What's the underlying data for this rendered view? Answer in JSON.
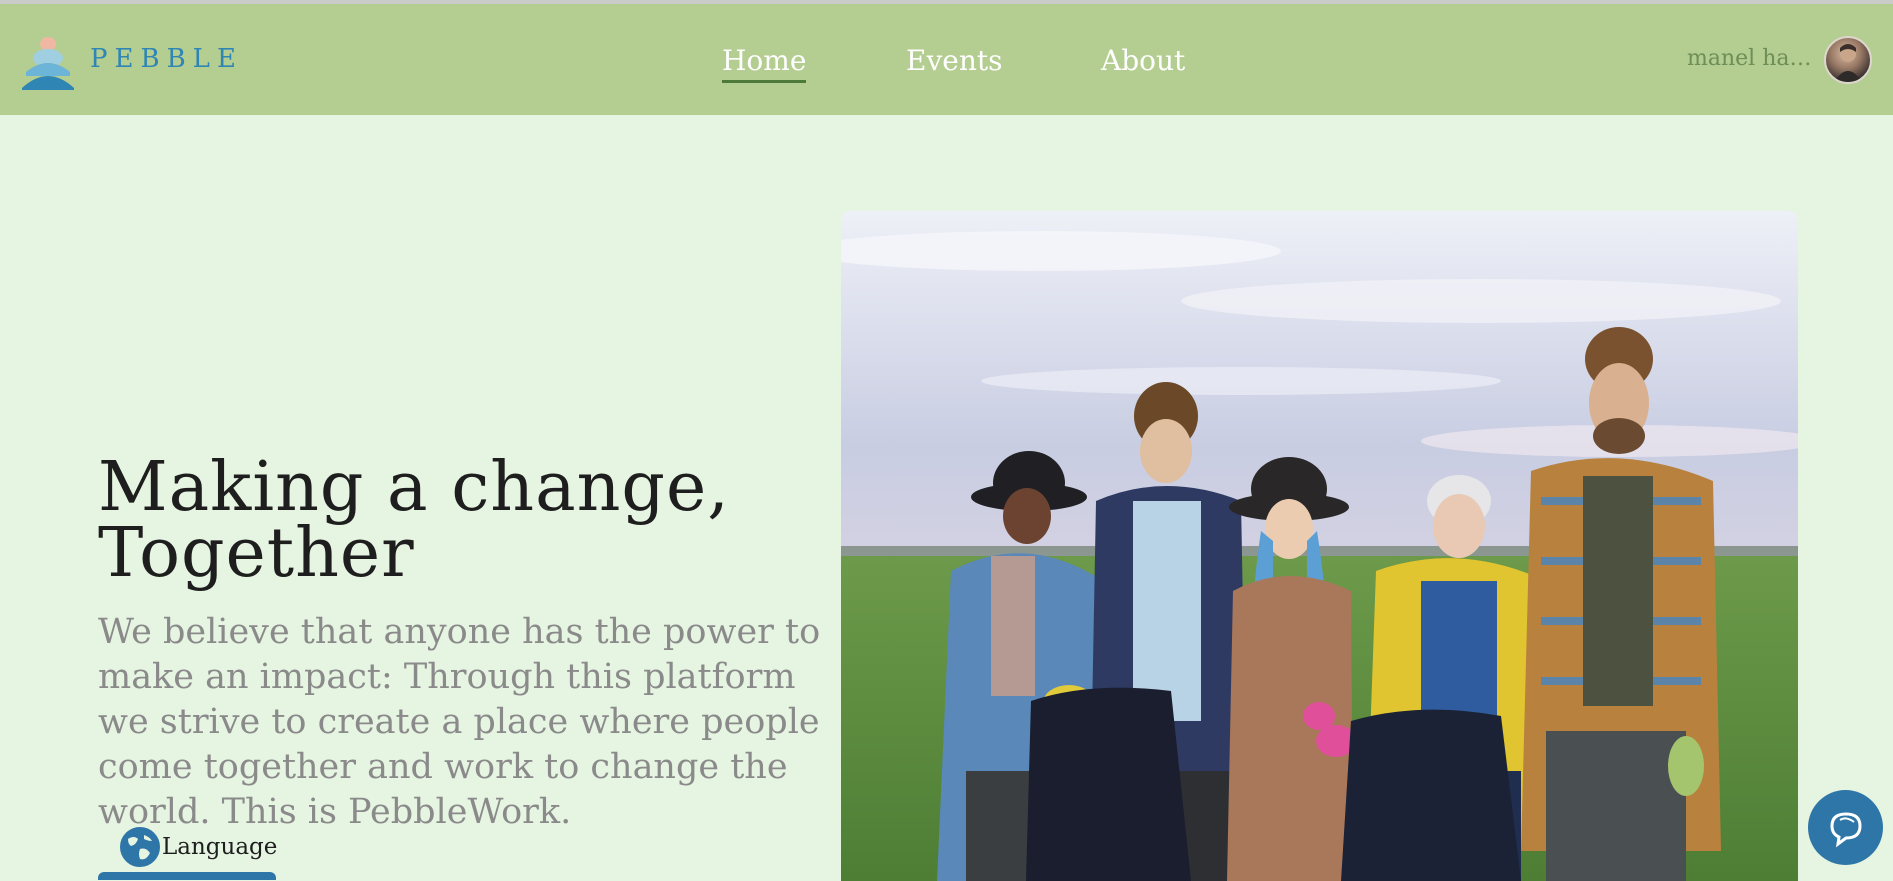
{
  "brand": {
    "name": "PEBBLE"
  },
  "nav": {
    "items": [
      {
        "label": "Home",
        "active": true
      },
      {
        "label": "Events",
        "active": false
      },
      {
        "label": "About",
        "active": false
      }
    ]
  },
  "user": {
    "name": "manel hadd..."
  },
  "hero": {
    "title_line1": "Making a change,",
    "title_line2": "Together",
    "description": "We believe that anyone has the power to make an impact: Through this platform we strive to create a place where people come together and work to change the world. This is PebbleWork."
  },
  "language": {
    "label": "Language"
  },
  "colors": {
    "navbar": "#b4cd90",
    "page_bg": "#e6f4e2",
    "brand": "#2f86b4",
    "accent": "#2f76a8"
  },
  "icons": {
    "logo": "pebble-logo-icon",
    "language": "globe-icon",
    "chat": "chat-bubbles-icon"
  }
}
